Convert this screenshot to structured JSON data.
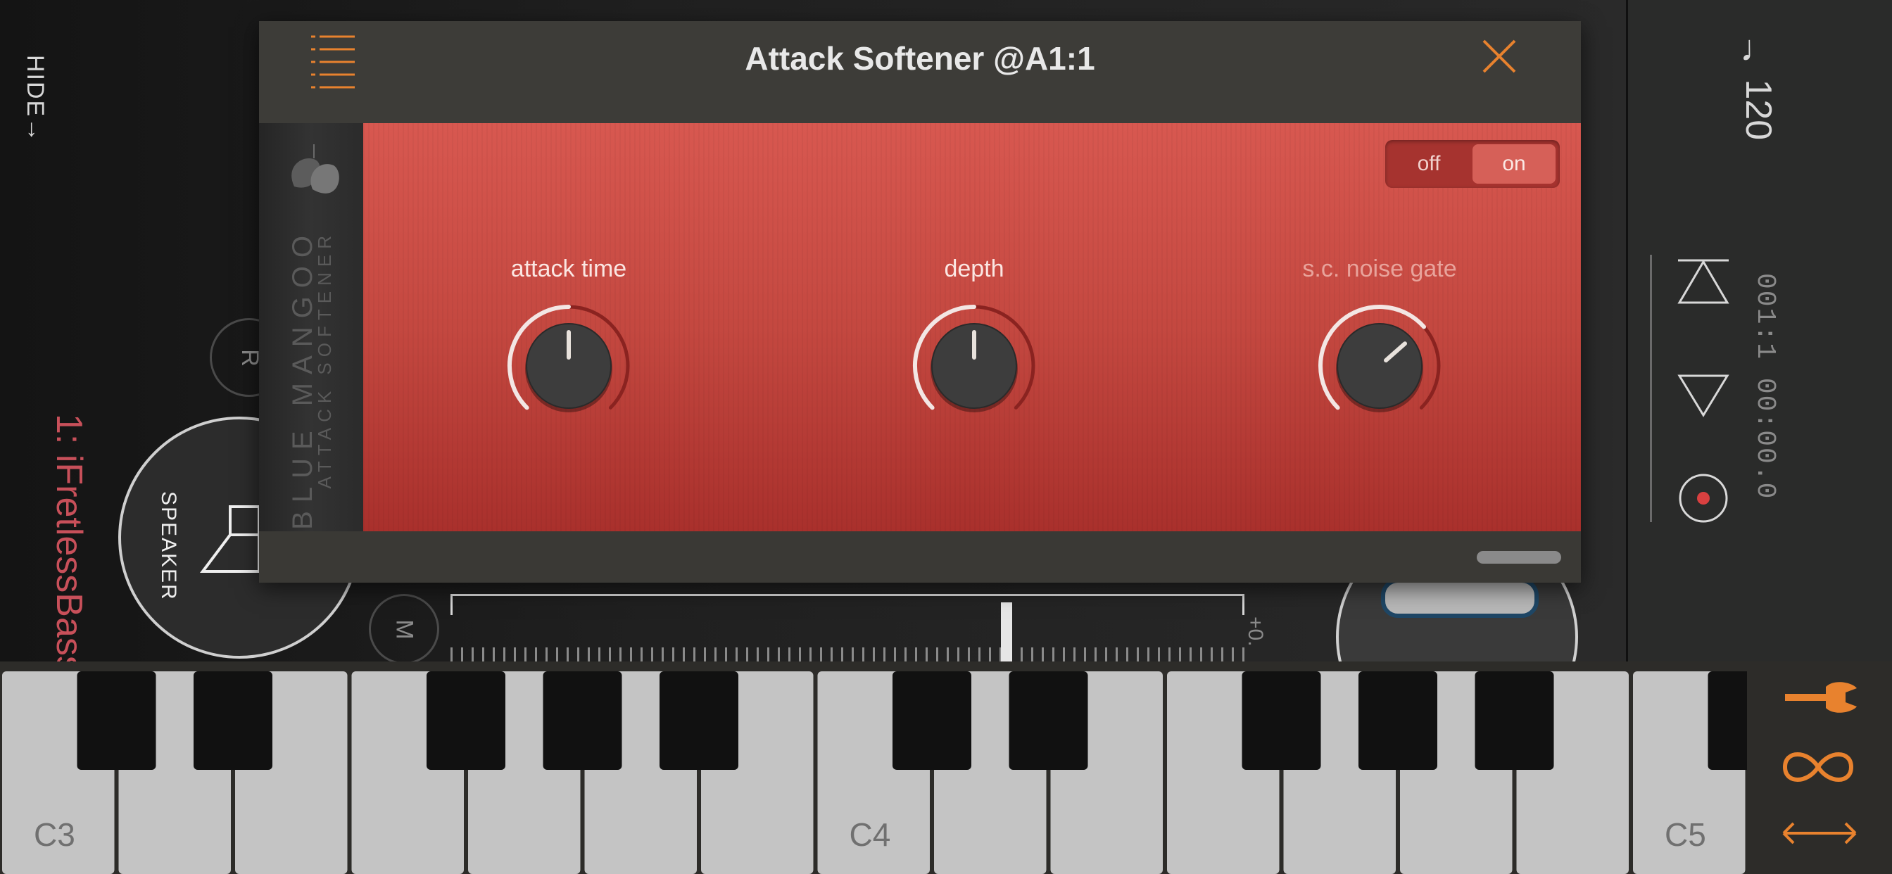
{
  "left_strip": {
    "hide_label": "HIDE→",
    "record_arm": "R",
    "mute": "M",
    "track_name": "1: iFretlessBass",
    "output_label": "SPEAKER",
    "fader_value": "+0."
  },
  "plugin": {
    "title": "Attack Softener @A1:1",
    "brand_name": "BLUE MANGOO",
    "brand_product": "ATTACK SOFTENER",
    "bypass": {
      "off_label": "off",
      "on_label": "on",
      "state": "on"
    },
    "knobs": [
      {
        "label": "attack time",
        "value": 0.5
      },
      {
        "label": "depth",
        "value": 0.5
      },
      {
        "label": "s.c. noise gate",
        "value": 0.68
      }
    ]
  },
  "transport": {
    "tempo": "♩ 120",
    "position": "001:1 00:00.0"
  },
  "keyboard": {
    "octave_labels": [
      "C3",
      "C4",
      "C5"
    ]
  },
  "colors": {
    "accent": "#e8822e",
    "plugin_face": "#c44840",
    "record": "#d94040"
  },
  "icons": [
    "menu-icon",
    "close-icon",
    "rewind-icon",
    "play-icon",
    "record-icon",
    "wrench-icon",
    "loop-icon",
    "expand-icon"
  ]
}
